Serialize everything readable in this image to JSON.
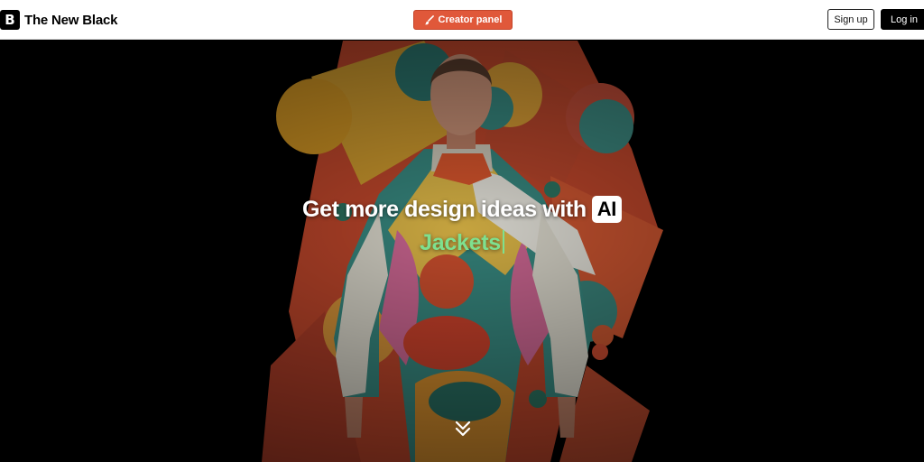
{
  "header": {
    "logo_mark": "B",
    "logo_text": "The New Black",
    "creator_panel_label": "Creator panel",
    "sign_up_label": "Sign up",
    "log_in_label": "Log in"
  },
  "hero": {
    "headline": "Get more design ideas with",
    "ai_badge": "AI",
    "typed_word": "Jackets",
    "scroll_icon": "double-chevron-down-icon"
  },
  "colors": {
    "accent": "#e0583a",
    "typed_text": "#7ee08f",
    "background": "#000000"
  }
}
